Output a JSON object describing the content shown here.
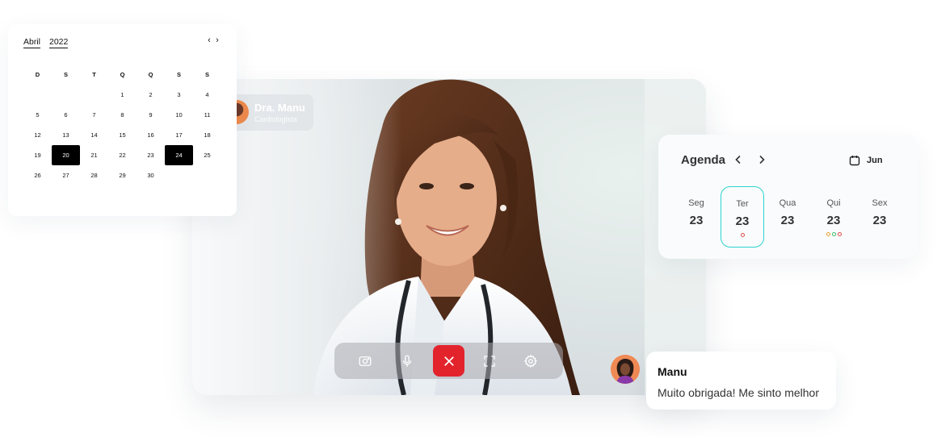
{
  "video_call": {
    "doctor_name": "Dra. Manu",
    "doctor_role": "Cardiologista",
    "controls": [
      "camera-icon",
      "microphone-icon",
      "close-icon",
      "fullscreen-icon",
      "gear-icon"
    ],
    "end_call_color": "#e3232c"
  },
  "mini_calendar": {
    "month": "Abril",
    "year": "2022",
    "prev": "‹",
    "next": "›",
    "weekdays": [
      "D",
      "S",
      "T",
      "Q",
      "Q",
      "S",
      "S"
    ],
    "weeks": [
      [
        "",
        "",
        "",
        "1",
        "2",
        "3",
        "4"
      ],
      [
        "5",
        "6",
        "7",
        "8",
        "9",
        "10",
        "11"
      ],
      [
        "12",
        "13",
        "14",
        "15",
        "16",
        "17",
        "18"
      ],
      [
        "19",
        "20",
        "21",
        "22",
        "23",
        "24",
        "25"
      ],
      [
        "26",
        "27",
        "28",
        "29",
        "30",
        "",
        ""
      ]
    ],
    "selected_days": [
      "20",
      "24"
    ]
  },
  "agenda": {
    "title": "Agenda",
    "month": "Jun",
    "accent": "#2dd4cf",
    "days": [
      {
        "dow": "Seg",
        "num": "23",
        "dots": []
      },
      {
        "dow": "Ter",
        "num": "23",
        "dots": [
          "#e24b4b"
        ],
        "active": true
      },
      {
        "dow": "Qua",
        "num": "23",
        "dots": []
      },
      {
        "dow": "Qui",
        "num": "23",
        "dots": [
          "#f0a030",
          "#3cbf6a",
          "#e24b4b"
        ]
      },
      {
        "dow": "Sex",
        "num": "23",
        "dots": []
      }
    ]
  },
  "chat": {
    "name": "Manu",
    "message": "Muito obrigada! Me sinto melhor"
  }
}
